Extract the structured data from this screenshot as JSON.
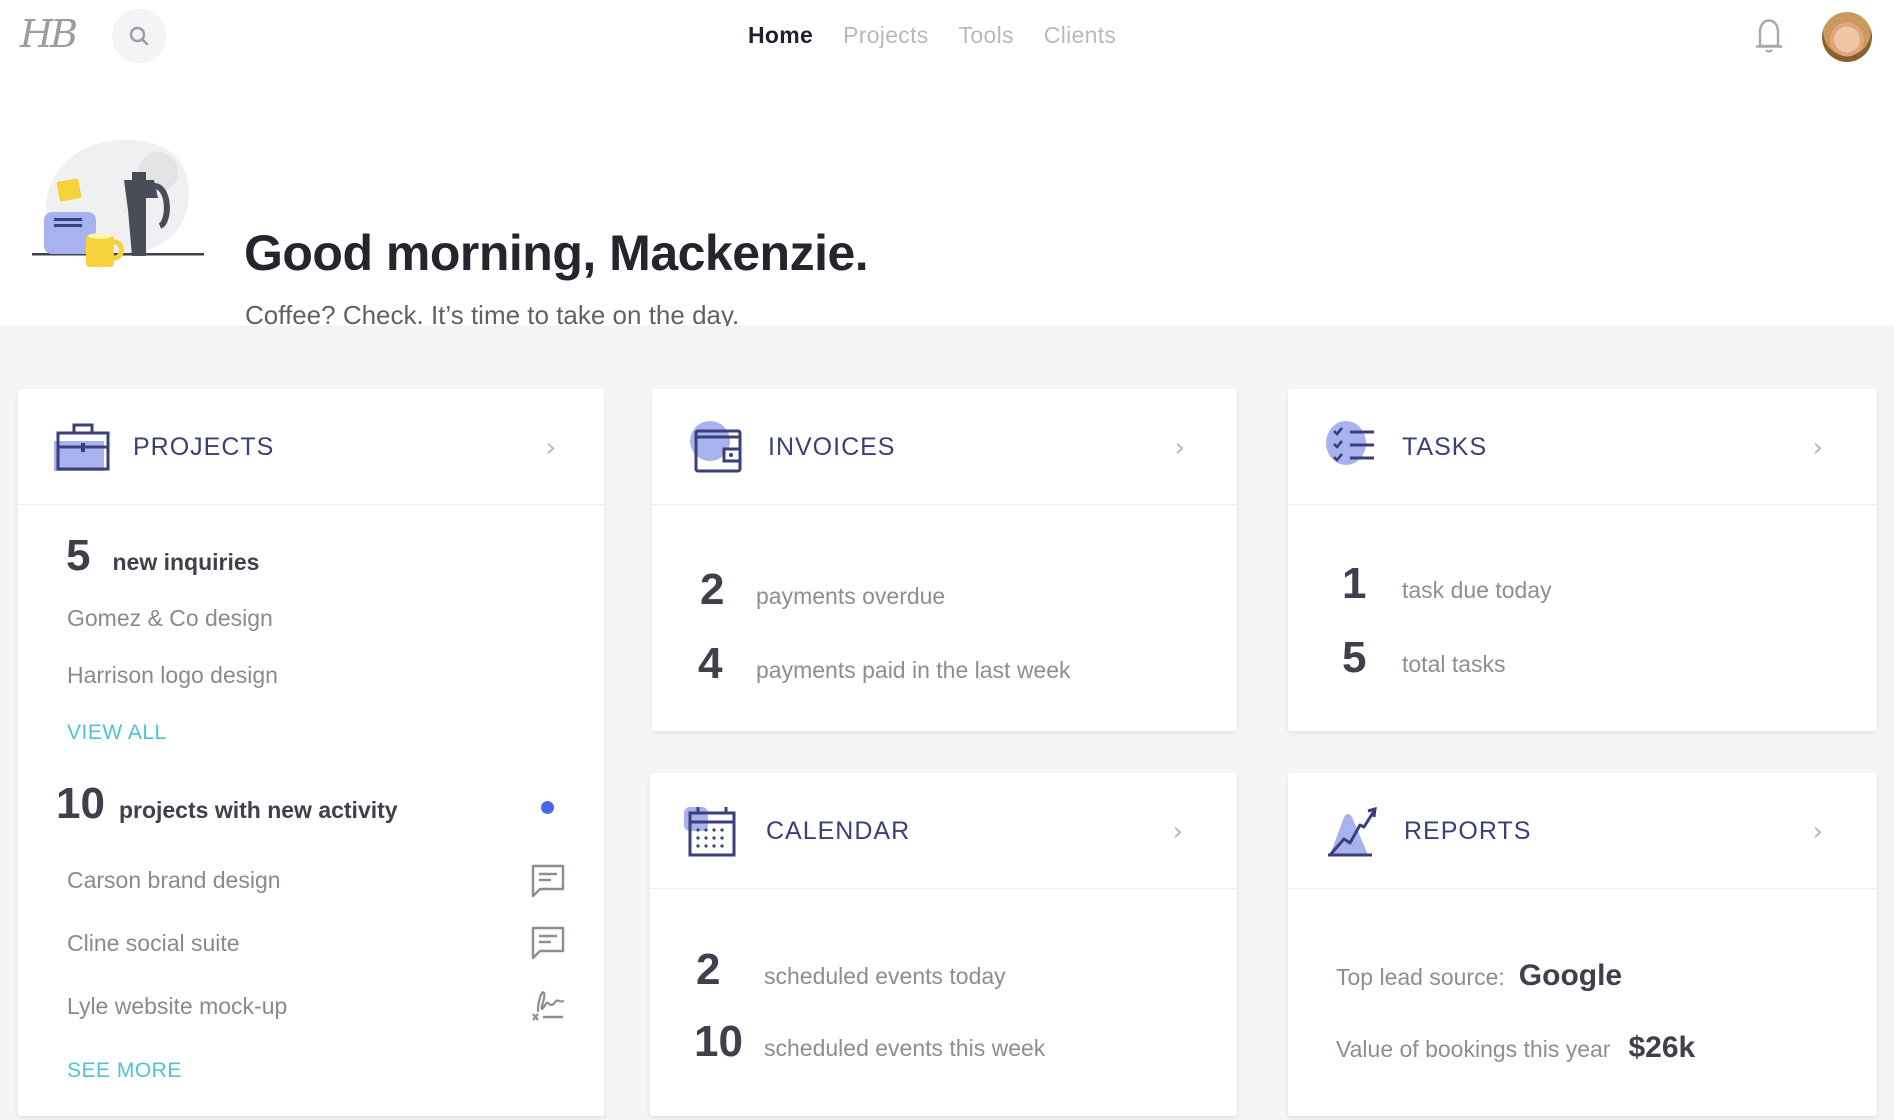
{
  "nav": {
    "logo": "HB",
    "search_icon": "search-icon",
    "links": [
      {
        "label": "Home",
        "active": true
      },
      {
        "label": "Projects",
        "active": false
      },
      {
        "label": "Tools",
        "active": false
      },
      {
        "label": "Clients",
        "active": false
      }
    ],
    "notifications_icon": "bell-icon",
    "avatar": "user-avatar"
  },
  "hero": {
    "greeting": "Good morning, Mackenzie.",
    "subtitle": "Coffee? Check. It’s time to take on the day."
  },
  "colors": {
    "accent_navy": "#3a3f79",
    "accent_lavender": "#a8b2ee",
    "link_teal": "#4fc3cf",
    "activity_dot": "#4d65e8",
    "background": "#f5f5f6"
  },
  "projects": {
    "title": "PROJECTS",
    "icon": "briefcase-icon",
    "inquiries": {
      "count": "5",
      "label": "new inquiries",
      "items": [
        "Gomez & Co design",
        "Harrison logo design"
      ],
      "link": "VIEW ALL"
    },
    "activity": {
      "count": "10",
      "label": "projects with new activity",
      "items": [
        {
          "name": "Carson brand design",
          "icon": "message-icon"
        },
        {
          "name": "Cline social suite",
          "icon": "message-icon"
        },
        {
          "name": "Lyle website mock-up",
          "icon": "signature-icon"
        }
      ],
      "link": "SEE MORE"
    }
  },
  "invoices": {
    "title": "INVOICES",
    "icon": "wallet-icon",
    "stats": [
      {
        "count": "2",
        "label": "payments overdue"
      },
      {
        "count": "4",
        "label": "payments paid in the last week"
      }
    ]
  },
  "tasks": {
    "title": "TASKS",
    "icon": "checklist-icon",
    "stats": [
      {
        "count": "1",
        "label": "task due today"
      },
      {
        "count": "5",
        "label": "total tasks"
      }
    ]
  },
  "calendar": {
    "title": "CALENDAR",
    "icon": "calendar-icon",
    "stats": [
      {
        "count": "2",
        "label": "scheduled events today"
      },
      {
        "count": "10",
        "label": "scheduled events this week"
      }
    ]
  },
  "reports": {
    "title": "REPORTS",
    "icon": "chart-trend-icon",
    "top_lead_label": "Top lead source:",
    "top_lead_value": "Google",
    "bookings_label": "Value of bookings this year",
    "bookings_value": "$26k"
  }
}
